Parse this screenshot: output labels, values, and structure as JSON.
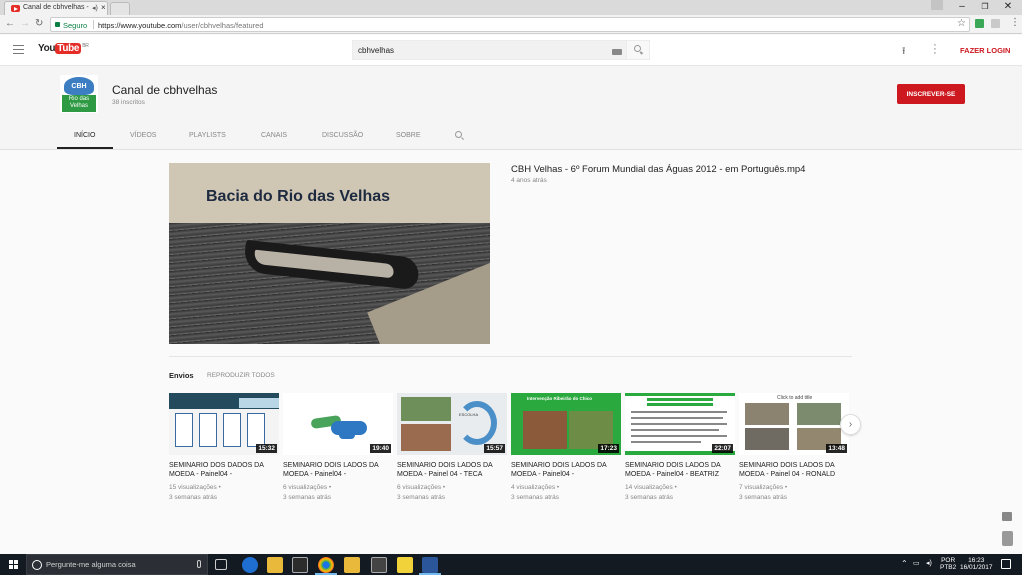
{
  "browser": {
    "tab_title": "Canal de cbhvelhas -",
    "tab_close": "×",
    "audio_icon": "speaker-icon",
    "secure_label": "Seguro",
    "url_host": "https://www.youtube.com",
    "url_path": "/user/cbhvelhas/featured",
    "window_controls": {
      "minimize": "–",
      "restore": "❐",
      "close": "✕"
    }
  },
  "youtube": {
    "logo_you": "You",
    "logo_tube": "Tube",
    "logo_region": "BR",
    "search_value": "cbhvelhas",
    "login_label": "FAZER LOGIN"
  },
  "channel": {
    "avatar_top": "CBH",
    "avatar_bottom": "Rio das Velhas",
    "name": "Canal de cbhvelhas",
    "subscribers": "38 inscritos",
    "subscribe_label": "INSCREVER-SE",
    "tabs": [
      "INÍCIO",
      "VÍDEOS",
      "PLAYLISTS",
      "CANAIS",
      "DISCUSSÃO",
      "SOBRE"
    ]
  },
  "featured": {
    "thumbnail_text": "Bacia do Rio das Velhas",
    "title": "CBH Velhas - 6º Forum Mundial das Águas 2012 - em Português.mp4",
    "age": "4 anos atrás"
  },
  "uploads": {
    "heading": "Envios",
    "play_all": "REPRODUZIR TODOS",
    "next_arrow": "›",
    "videos": [
      {
        "title": "SEMINÁRIO DOS DADOS DA MOEDA - Painel04 -",
        "duration": "15:32",
        "views": "15 visualizações •",
        "age": "3 semanas atrás"
      },
      {
        "title": "SEMINÁRIO DOIS LADOS DA MOEDA - Painel04 -",
        "duration": "19:40",
        "views": "6 visualizações •",
        "age": "3 semanas atrás"
      },
      {
        "title": "SEMINÁRIO DOIS LADOS DA MOEDA - Painel 04 - TECA",
        "duration": "15:57",
        "views": "6 visualizações •",
        "age": "3 semanas atrás"
      },
      {
        "title": "SEMINÁRIO DOIS LADOS DA MOEDA - Painel04 -",
        "duration": "17:23",
        "views": "4 visualizações •",
        "age": "3 semanas atrás"
      },
      {
        "title": "SEMINÁRIO DOIS LADOS DA MOEDA - Painel04 - BEATRIZ",
        "duration": "22:07",
        "views": "14 visualizações •",
        "age": "3 semanas atrás"
      },
      {
        "title": "SEMINÁRIO DOIS LADOS DA MOEDA - Painel 04 - RONALD",
        "duration": "13:48",
        "views": "7 visualizações •",
        "age": "3 semanas atrás"
      }
    ],
    "thumb_texts": [
      "ESCOLHA",
      "Intervenção Ribeirão do Chico",
      "Click to add title"
    ]
  },
  "taskbar": {
    "search_placeholder": "Pergunte-me alguma coisa",
    "lang_top": "POR",
    "lang_bottom": "PTB2",
    "time": "16:23",
    "date": "16/01/2017"
  },
  "colors": {
    "brand_red": "#cc181e",
    "youtube_red": "#e52d27",
    "secure_green": "#0b8043",
    "taskbar": "#141a22"
  }
}
